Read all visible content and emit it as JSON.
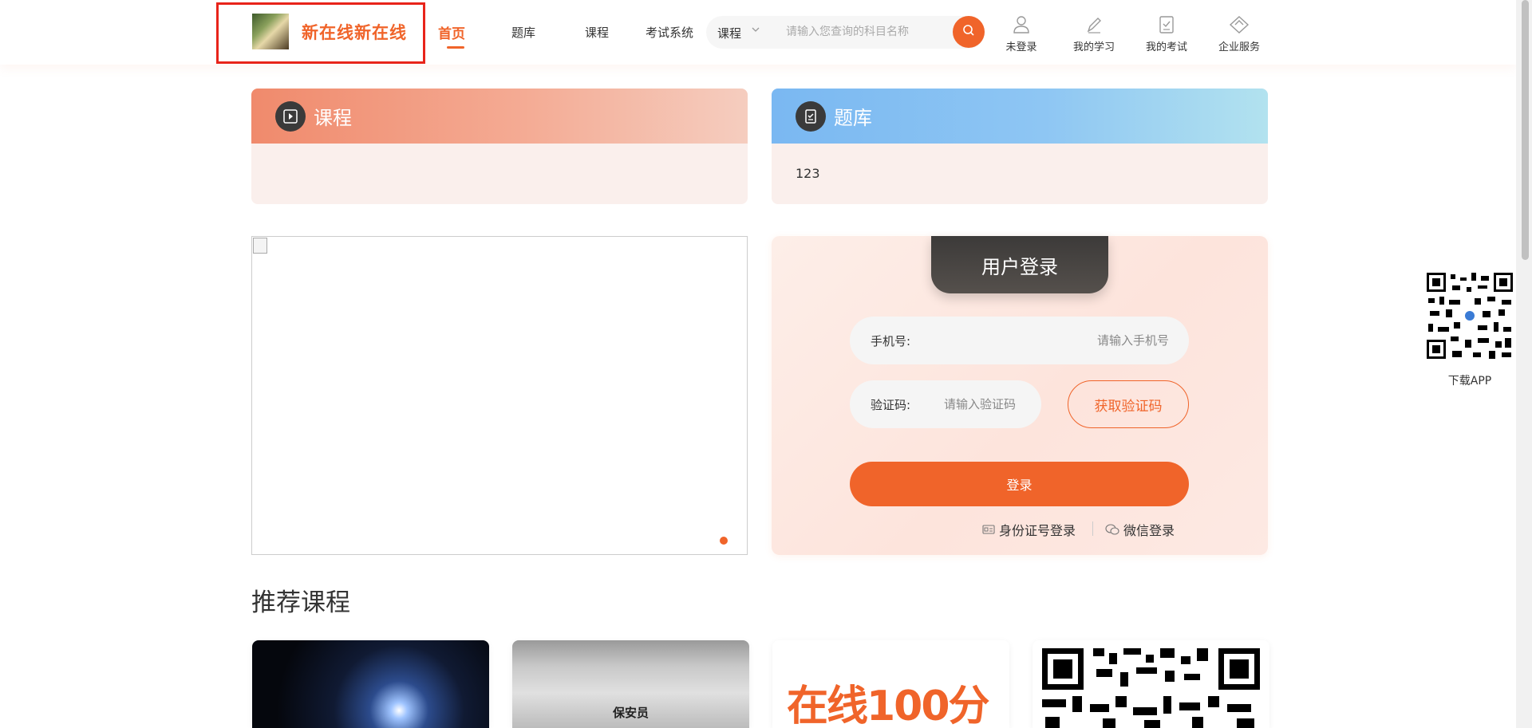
{
  "header": {
    "site_name": "新在线新在线",
    "nav": [
      {
        "label": "首页",
        "active": true
      },
      {
        "label": "题库",
        "active": false
      },
      {
        "label": "课程",
        "active": false
      },
      {
        "label": "考试系统",
        "active": false
      }
    ],
    "search": {
      "category": "课程",
      "placeholder": "请输入您查询的科目名称"
    },
    "user_nav": [
      {
        "label": "未登录",
        "icon": "user-icon"
      },
      {
        "label": "我的学习",
        "icon": "pencil-icon"
      },
      {
        "label": "我的考试",
        "icon": "clipboard-icon"
      },
      {
        "label": "企业服务",
        "icon": "enterprise-icon"
      }
    ]
  },
  "cards": {
    "course": {
      "title": "课程",
      "body": ""
    },
    "question_bank": {
      "title": "题库",
      "body": "123"
    }
  },
  "login": {
    "title": "用户登录",
    "phone_label": "手机号:",
    "phone_placeholder": "请输入手机号",
    "code_label": "验证码:",
    "code_placeholder": "请输入验证码",
    "get_code": "获取验证码",
    "submit": "登录",
    "id_login": "身份证号登录",
    "wechat_login": "微信登录"
  },
  "recommended": {
    "title": "推荐课程",
    "cards": [
      {
        "caption": ""
      },
      {
        "caption": "保安员"
      },
      {
        "caption": "在线100分"
      },
      {
        "caption": ""
      }
    ]
  },
  "side": {
    "download_label": "下载APP"
  },
  "colors": {
    "accent": "#f0642a",
    "card_course_header": "#f08a6c",
    "card_bank_header": "#7ab8f2",
    "highlight_box": "#e8241a"
  }
}
